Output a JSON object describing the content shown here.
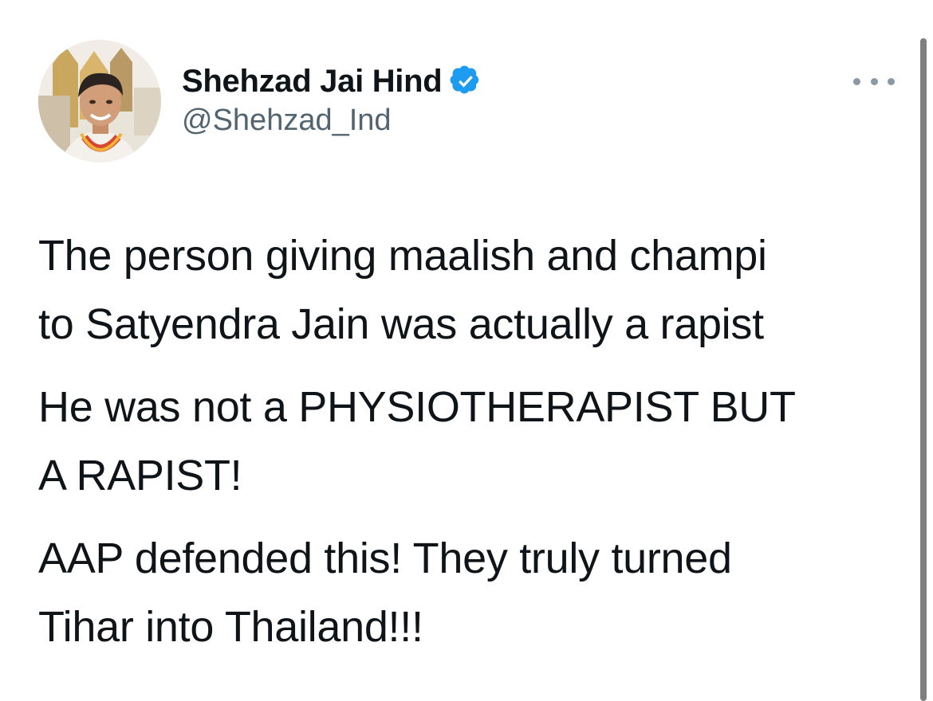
{
  "author": {
    "display_name": "Shehzad Jai Hind",
    "handle": "@Shehzad_Ind",
    "verified": true,
    "verified_icon": "verified-badge-icon",
    "avatar_icon": "profile-photo"
  },
  "tweet": {
    "paragraphs": [
      "The person giving maalish and champi\nto Satyendra Jain was actually a rapist",
      "He was not a PHYSIOTHERAPIST BUT\nA RAPIST!",
      "AAP defended this! They truly turned\nTihar into Thailand!!!"
    ]
  },
  "actions": {
    "more_icon": "more-options-icon"
  },
  "colors": {
    "text": "#0f1419",
    "handle": "#536471",
    "verified": "#1d9bf0",
    "more_dots": "#8b98a5",
    "scrollbar": "#7f7f7f"
  }
}
